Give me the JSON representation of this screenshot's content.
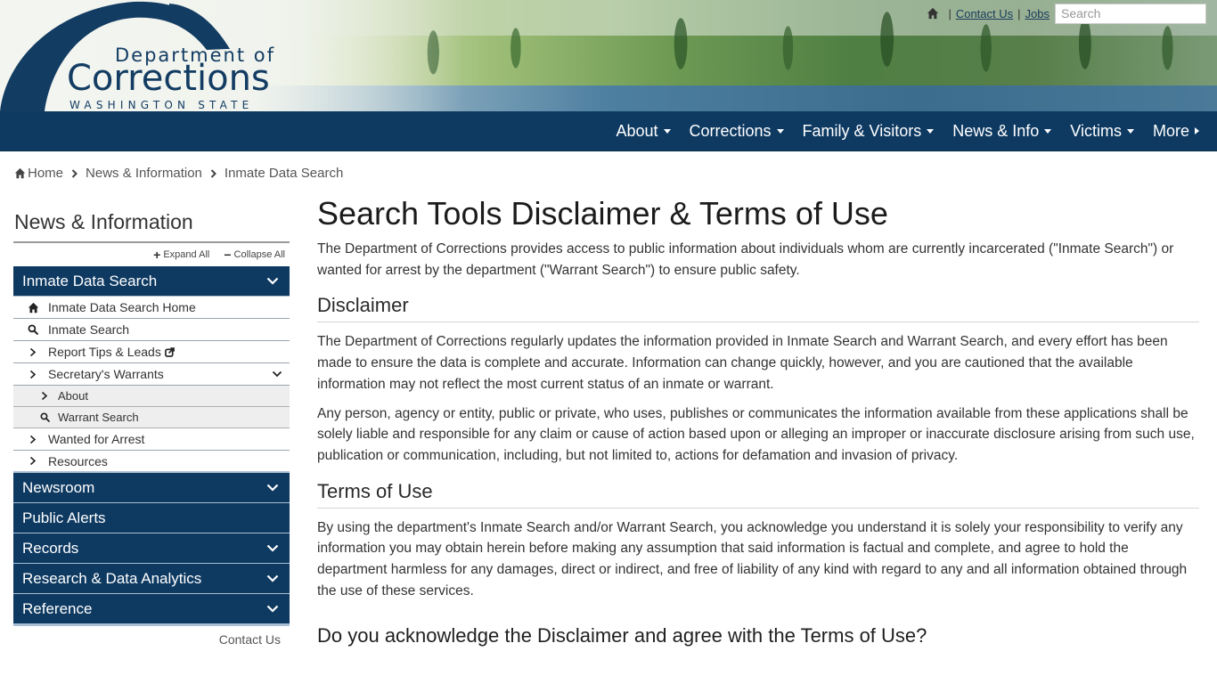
{
  "logo": {
    "line1": "Department of",
    "line2": "Corrections",
    "line3": "WASHINGTON STATE"
  },
  "utility": {
    "home_icon": "home-icon",
    "separator": "|",
    "links": [
      {
        "label": "Contact Us"
      },
      {
        "label": "Jobs"
      }
    ],
    "search": {
      "placeholder": "Search",
      "value": "",
      "icon": "search-icon"
    }
  },
  "nav": {
    "items": [
      {
        "label": "About",
        "caret": "down"
      },
      {
        "label": "Corrections",
        "caret": "down"
      },
      {
        "label": "Family & Visitors",
        "caret": "down"
      },
      {
        "label": "News & Info",
        "caret": "down"
      },
      {
        "label": "Victims",
        "caret": "down"
      },
      {
        "label": "More",
        "caret": "right"
      }
    ]
  },
  "breadcrumb": {
    "items": [
      {
        "label": "Home",
        "icon": "home-icon"
      },
      {
        "label": "News & Information"
      },
      {
        "label": "Inmate Data Search"
      }
    ]
  },
  "sidebar": {
    "title": "News & Information",
    "expand_all": "Expand All",
    "collapse_all": "Collapse All",
    "active_category": "Inmate Data Search",
    "sub_items": [
      {
        "label": "Inmate Data Search Home",
        "icon": "home-icon"
      },
      {
        "label": "Inmate Search",
        "icon": "search-icon"
      },
      {
        "label": "Report Tips & Leads",
        "icon": "chevron-right-icon",
        "external": true
      },
      {
        "label": "Secretary's Warrants",
        "icon": "chevron-right-icon",
        "expanded": true
      },
      {
        "label": "About",
        "icon": "chevron-right-icon",
        "level": 2
      },
      {
        "label": "Warrant Search",
        "icon": "search-icon",
        "level": 2
      },
      {
        "label": "Wanted for Arrest",
        "icon": "chevron-right-icon"
      },
      {
        "label": "Resources",
        "icon": "chevron-right-icon"
      }
    ],
    "categories": [
      {
        "label": "Newsroom",
        "has_children": true
      },
      {
        "label": "Public Alerts",
        "has_children": false
      },
      {
        "label": "Records",
        "has_children": true
      },
      {
        "label": "Research & Data Analytics",
        "has_children": true
      },
      {
        "label": "Reference",
        "has_children": true
      }
    ],
    "contact": "Contact Us"
  },
  "main": {
    "title": "Search Tools Disclaimer & Terms of Use",
    "intro": "The Department of Corrections provides access to public information about individuals whom are currently incarcerated (\"Inmate Search\") or wanted for arrest by the department (\"Warrant Search\") to ensure public safety.",
    "disclaimer": {
      "heading": "Disclaimer",
      "paragraphs": [
        "The Department of Corrections regularly updates the information provided in Inmate Search and Warrant Search, and every effort has been made to ensure the data is complete and accurate. Information can change quickly, however, and you are cautioned that the available information may not reflect the most current status of an inmate or warrant.",
        "Any person, agency or entity, public or private, who uses, publishes or communicates the information available from these applications shall be solely liable and responsible for any claim or cause of action based upon or alleging an improper or inaccurate disclosure arising from such use, publication or communication, including, but not limited to, actions for defamation and invasion of privacy."
      ]
    },
    "terms": {
      "heading": "Terms of Use",
      "paragraphs": [
        "By using the department's Inmate Search and/or Warrant Search, you acknowledge you understand it is solely your responsibility to verify any information you may obtain herein before making any assumption that said information is factual and complete, and agree to hold the department harmless for any damages, direct or indirect, and free of liability of any kind with regard to any and all information obtained through the use of these services."
      ]
    },
    "question": "Do you acknowledge the Disclaimer and agree with the Terms of Use?"
  },
  "colors": {
    "brand_navy": "#0e3a62",
    "divider_light": "#a9bfd3",
    "submenu_bg": "#eeeeee"
  }
}
